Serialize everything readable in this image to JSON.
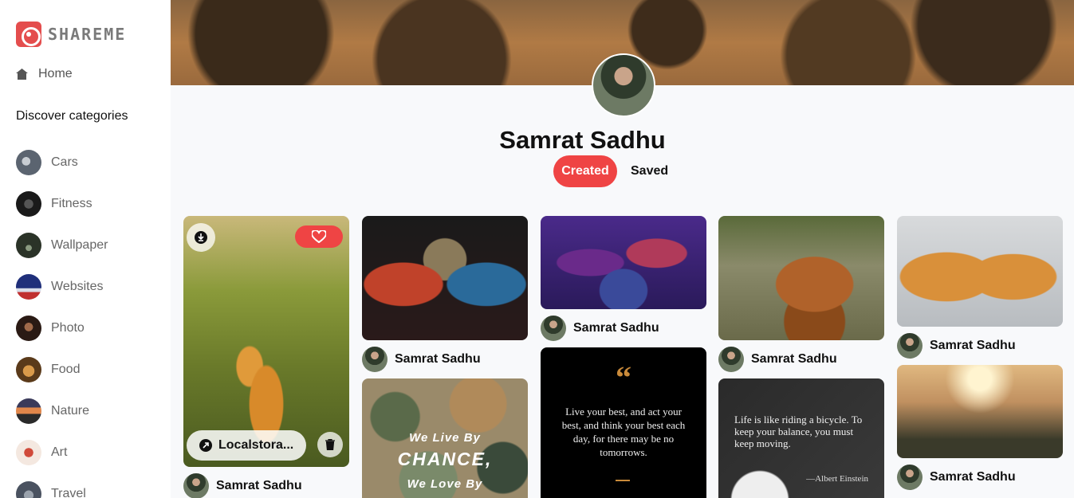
{
  "app": {
    "name": "SHAREME"
  },
  "sidebar": {
    "home_label": "Home",
    "discover_title": "Discover categories",
    "categories": [
      {
        "label": "Cars",
        "color": "#5b6470"
      },
      {
        "label": "Fitness",
        "color": "#2a2a2a"
      },
      {
        "label": "Wallpaper",
        "color": "#3e4a3a"
      },
      {
        "label": "Websites",
        "color": "#2c3e8c"
      },
      {
        "label": "Photo",
        "color": "#4a2f24"
      },
      {
        "label": "Food",
        "color": "#8a5a2a"
      },
      {
        "label": "Nature",
        "color": "#b0663a"
      },
      {
        "label": "Art",
        "color": "#c84a3a"
      },
      {
        "label": "Travel",
        "color": "#6a7280"
      }
    ]
  },
  "profile": {
    "name": "Samrat Sadhu",
    "tabs": {
      "created": "Created",
      "saved": "Saved"
    }
  },
  "pins": {
    "user_name": "Samrat Sadhu",
    "hover_link_label": "Localstora...",
    "quotes": {
      "q1": "Live your best, and act your best, and think your best each day, for there may be no tomorrows.",
      "q1_mark": "“",
      "q2": "Life is like riding a bicycle. To keep your balance, you must keep moving.",
      "q2_author": "—Albert Einstein",
      "poster_line1": "We Live By",
      "poster_line2": "CHANCE,",
      "poster_line3": "We Love By"
    }
  },
  "colors": {
    "accent": "#ef4444"
  }
}
